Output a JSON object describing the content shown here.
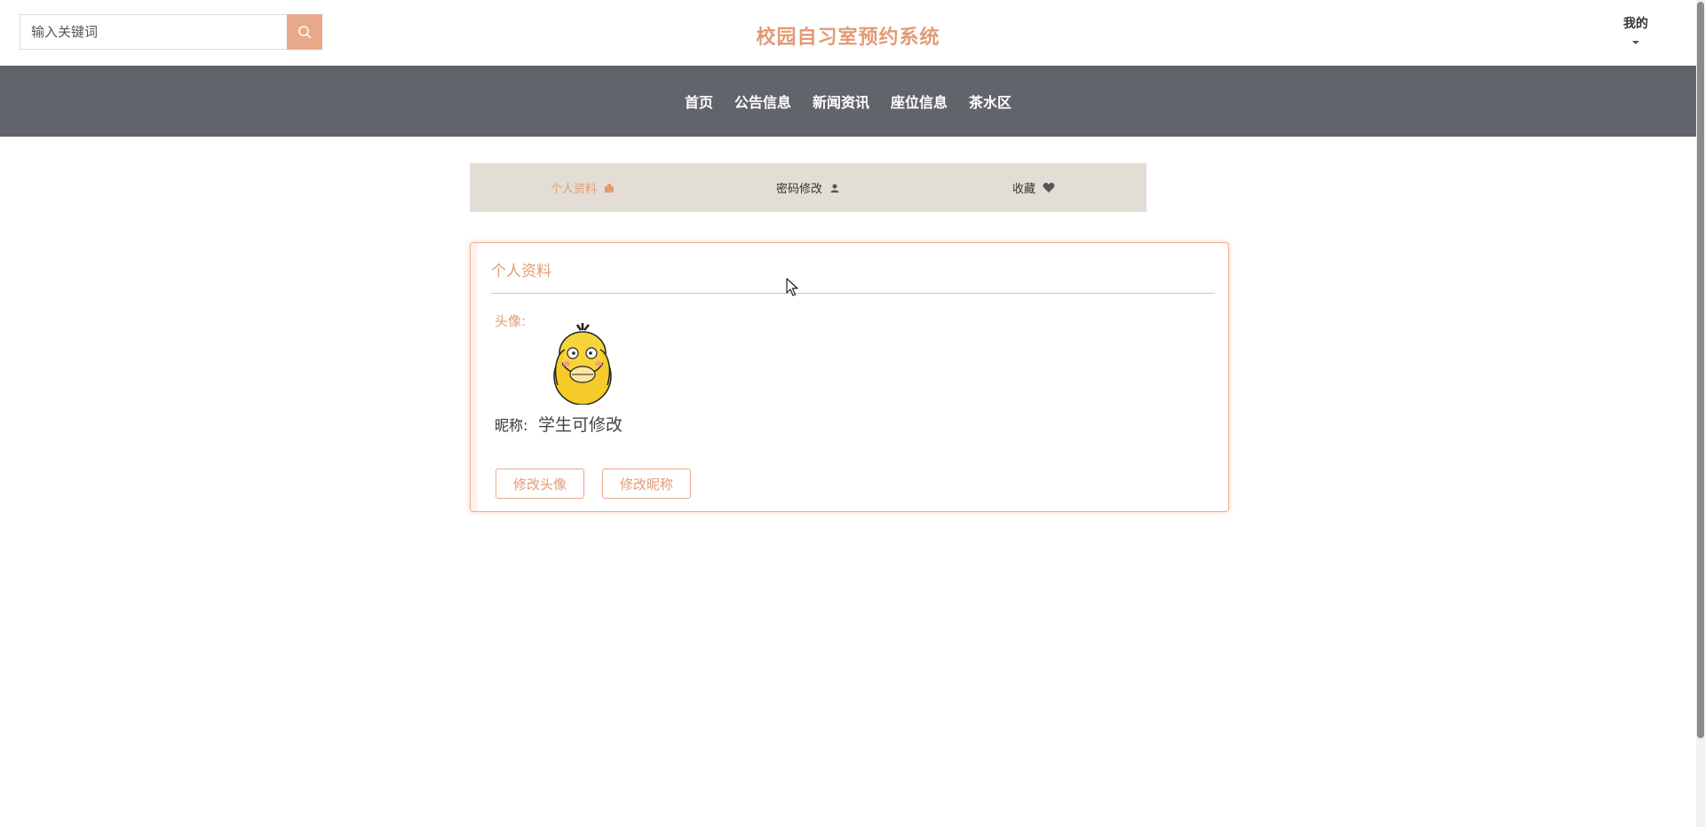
{
  "header": {
    "search_placeholder": "输入关键词",
    "site_title": "校园自习室预约系统",
    "my_label": "我的"
  },
  "nav": {
    "items": [
      "首页",
      "公告信息",
      "新闻资讯",
      "座位信息",
      "茶水区"
    ]
  },
  "tabs": {
    "profile": "个人资料",
    "password": "密码修改",
    "favorites": "收藏"
  },
  "panel": {
    "title": "个人资料",
    "avatar_label": "头像:",
    "nickname_label": "昵称:",
    "nickname_value": "学生可修改",
    "change_avatar": "修改头像",
    "change_nickname": "修改昵称"
  },
  "colors": {
    "accent": "#e39a74",
    "nav_bg": "#62646c",
    "tab_bg": "#e3ded5"
  },
  "icons": [
    "search-icon",
    "profile-icon",
    "user-icon",
    "heart-icon",
    "chevron-down-icon"
  ]
}
